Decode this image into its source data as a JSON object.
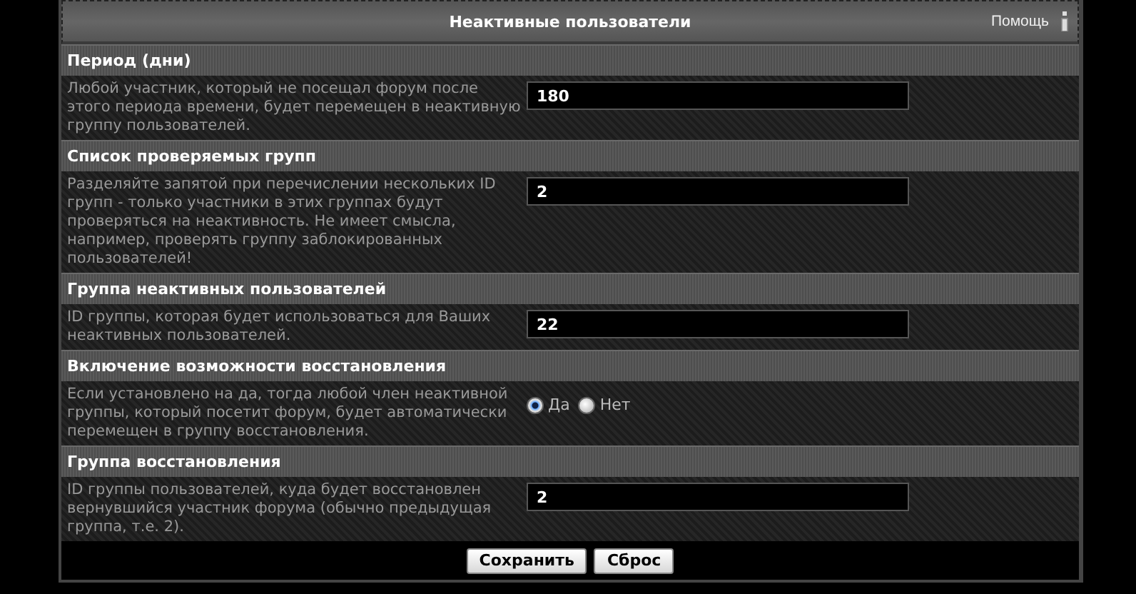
{
  "panel": {
    "title": "Неактивные пользователи",
    "help_link": "Помощь"
  },
  "sections": [
    {
      "title": "Период (дни)",
      "description": "Любой участник, который не посещал форум после этого периода времени, будет перемещен в неактивную группу пользователей.",
      "kind": "text",
      "value": "180"
    },
    {
      "title": "Список проверяемых групп",
      "description": "Разделяйте запятой при перечислении нескольких ID групп - только участники в этих группах будут проверяться на неактивность. Не имеет смысла, например, проверять группу заблокированных пользователей!",
      "kind": "text",
      "value": "2"
    },
    {
      "title": "Группа неактивных пользователей",
      "description": "ID группы, которая будет использоваться для Ваших неактивных пользователей.",
      "kind": "text",
      "value": "22"
    },
    {
      "title": "Включение возможности восстановления",
      "description": "Если установлено на да, тогда любой член неактивной группы, который посетит форум, будет автоматически перемещен в группу восстановления.",
      "kind": "radio",
      "options": [
        {
          "label": "Да",
          "selected": true
        },
        {
          "label": "Нет",
          "selected": false
        }
      ]
    },
    {
      "title": "Группа восстановления",
      "description": "ID группы пользователей, куда будет восстановлен вернувшийся участник форума (обычно предыдущая группа, т.е. 2).",
      "kind": "text",
      "value": "2"
    }
  ],
  "buttons": [
    "Сохранить",
    "Сброс"
  ]
}
